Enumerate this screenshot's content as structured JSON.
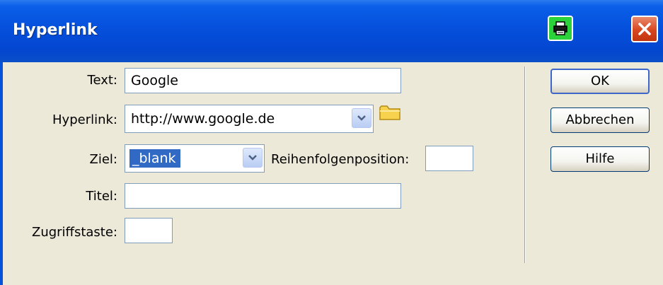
{
  "window": {
    "title": "Hyperlink"
  },
  "form": {
    "text": {
      "label": "Text:",
      "value": "Google"
    },
    "hyperlink": {
      "label": "Hyperlink:",
      "value": "http://www.google.de"
    },
    "ziel": {
      "label": "Ziel:",
      "value": "_blank"
    },
    "reihenfolge": {
      "label": "Reihenfolgenposition:",
      "value": ""
    },
    "titel": {
      "label": "Titel:",
      "value": ""
    },
    "zugriffstaste": {
      "label": "Zugriffstaste:",
      "value": ""
    }
  },
  "buttons": {
    "ok": "OK",
    "cancel": "Abbrechen",
    "help": "Hilfe"
  },
  "colors": {
    "titlebar": "#0550dc",
    "selection": "#316ac5",
    "help_icon_bg": "#2bd23a",
    "close_bg": "#d8461f"
  },
  "icons": {
    "title_help": "printer-icon",
    "close": "close-icon",
    "browse": "folder-icon",
    "dropdown": "chevron-down-icon"
  }
}
